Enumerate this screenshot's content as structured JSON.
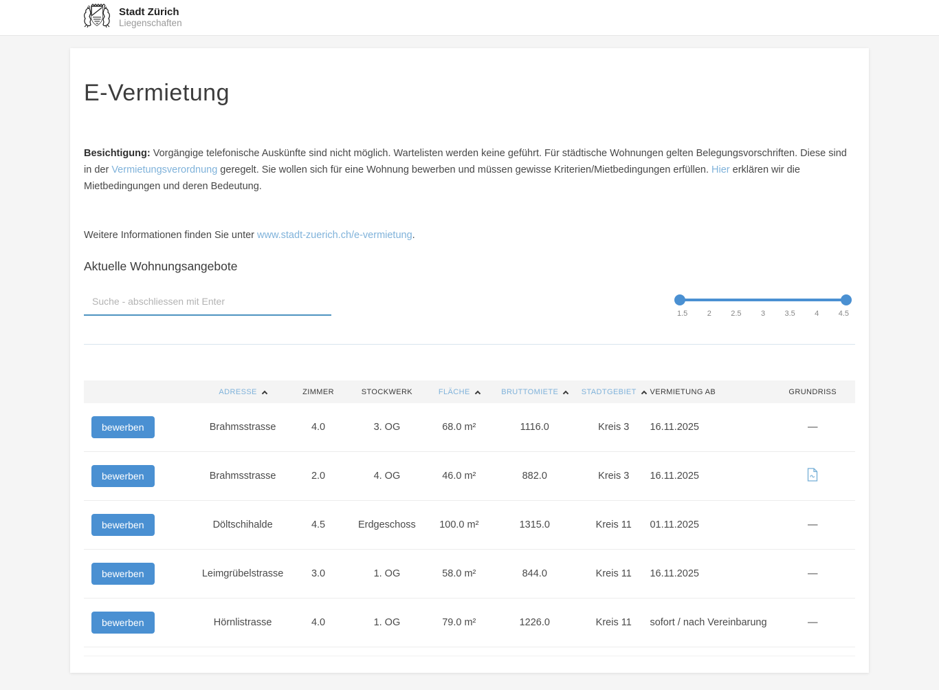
{
  "header": {
    "brand_title": "Stadt Zürich",
    "brand_subtitle": "Liegenschaften"
  },
  "page": {
    "title": "E-Vermietung",
    "intro": {
      "bold_label": "Besichtigung:",
      "text_1": " Vorgängige telefonische Auskünfte sind nicht möglich. Wartelisten werden keine geführt. Für städtische Wohnungen gelten Belegungsvorschriften. Diese sind in der ",
      "link_1": "Vermietungsverordnung",
      "text_2": " geregelt. Sie wollen sich für eine Wohnung bewerben und müssen gewisse Kriterien/Mietbedingungen erfüllen. ",
      "link_2": "Hier",
      "text_3": " erklären wir die Mietbedingungen und deren Bedeutung."
    },
    "more_info_text": "Weitere Informationen finden Sie unter ",
    "more_info_link": "www.stadt-zuerich.ch/e-vermietung",
    "more_info_suffix": ".",
    "section_heading": "Aktuelle Wohnungsangebote"
  },
  "search": {
    "placeholder": "Suche - abschliessen mit Enter"
  },
  "slider": {
    "min_value": "1.5",
    "max_value": "4.5",
    "ticks": [
      "1.5",
      "2",
      "2.5",
      "3",
      "3.5",
      "4",
      "4.5"
    ]
  },
  "table": {
    "apply_label": "bewerben",
    "columns": [
      {
        "label": "ADRESSE",
        "sorted": true
      },
      {
        "label": "ZIMMER",
        "sorted": false
      },
      {
        "label": "STOCKWERK",
        "sorted": false
      },
      {
        "label": "FLÄCHE",
        "sorted": true
      },
      {
        "label": "BRUTTOMIETE",
        "sorted": true
      },
      {
        "label": "STADTGEBIET",
        "sorted": true
      },
      {
        "label": "VERMIETUNG AB",
        "sorted": false
      },
      {
        "label": "GRUNDRISS",
        "sorted": false
      }
    ],
    "rows": [
      {
        "adresse": "Brahmsstrasse",
        "zimmer": "4.0",
        "stockwerk": "3. OG",
        "flaeche": "68.0 m²",
        "bruttomiete": "1116.0",
        "stadtgebiet": "Kreis 3",
        "vermietung_ab": "16.11.2025",
        "grundriss": "—"
      },
      {
        "adresse": "Brahmsstrasse",
        "zimmer": "2.0",
        "stockwerk": "4. OG",
        "flaeche": "46.0 m²",
        "bruttomiete": "882.0",
        "stadtgebiet": "Kreis 3",
        "vermietung_ab": "16.11.2025",
        "grundriss": "pdf",
        "grundriss_icon": "pdf-file-icon"
      },
      {
        "adresse": "Döltschihalde",
        "zimmer": "4.5",
        "stockwerk": "Erdgeschoss",
        "flaeche": "100.0 m²",
        "bruttomiete": "1315.0",
        "stadtgebiet": "Kreis 11",
        "vermietung_ab": "01.11.2025",
        "grundriss": "—"
      },
      {
        "adresse": "Leimgrübelstrasse",
        "zimmer": "3.0",
        "stockwerk": "1. OG",
        "flaeche": "58.0 m²",
        "bruttomiete": "844.0",
        "stadtgebiet": "Kreis 11",
        "vermietung_ab": "16.11.2025",
        "grundriss": "—"
      },
      {
        "adresse": "Hörnlistrasse",
        "zimmer": "4.0",
        "stockwerk": "1. OG",
        "flaeche": "79.0 m²",
        "bruttomiete": "1226.0",
        "stadtgebiet": "Kreis 11",
        "vermietung_ab": "sofort / nach Vereinbarung",
        "grundriss": "—"
      }
    ]
  },
  "colors": {
    "accent_blue": "#4a90d2",
    "link_blue": "#7fb2da",
    "search_underline": "#4d93c0",
    "header_bg": "#f4f4f4",
    "page_bg": "#f5f5f5"
  }
}
